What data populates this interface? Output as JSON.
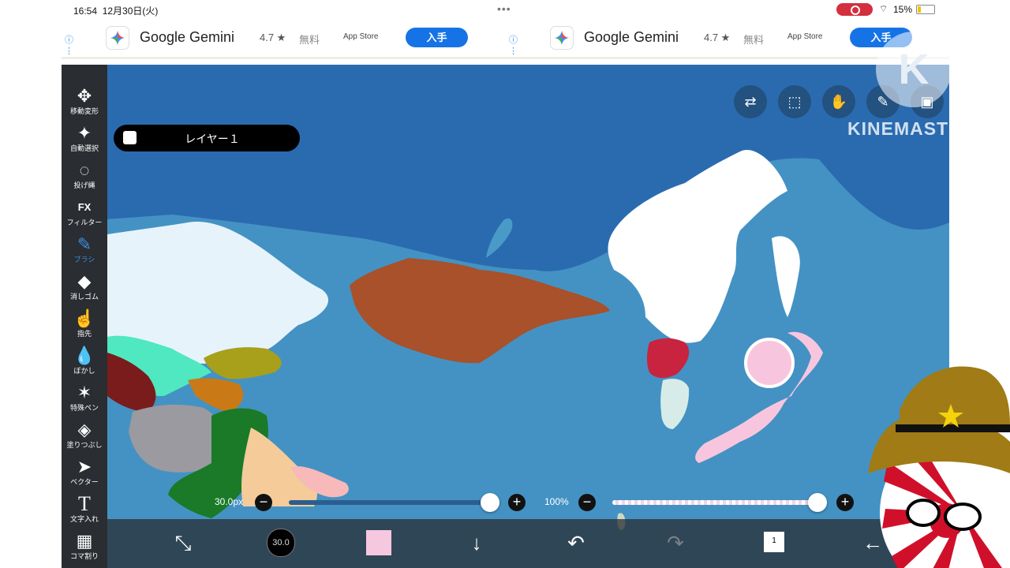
{
  "status_bar": {
    "time": "16:54",
    "date": "12月30日(火)",
    "battery": "15%"
  },
  "ads": [
    {
      "app_name": "Google Gemini",
      "rating": "4.7 ★",
      "price": "無料",
      "store": "App Store",
      "get_label": "入手"
    },
    {
      "app_name": "Google Gemini",
      "rating": "4.7 ★",
      "price": "無料",
      "store": "App Store",
      "get_label": "入手"
    }
  ],
  "toolbar": {
    "items": [
      {
        "label": "移動変形",
        "icon": "move-icon"
      },
      {
        "label": "自動選択",
        "icon": "magic-wand-icon"
      },
      {
        "label": "投げ縄",
        "icon": "lasso-icon"
      },
      {
        "label": "フィルター",
        "icon": "fx-icon"
      },
      {
        "label": "ブラシ",
        "icon": "brush-icon"
      },
      {
        "label": "消しゴム",
        "icon": "eraser-icon"
      },
      {
        "label": "指先",
        "icon": "finger-icon"
      },
      {
        "label": "ぼかし",
        "icon": "blur-icon"
      },
      {
        "label": "特殊ペン",
        "icon": "special-pen-icon"
      },
      {
        "label": "塗りつぶし",
        "icon": "fill-icon"
      },
      {
        "label": "ベクター",
        "icon": "vector-icon"
      },
      {
        "label": "文字入れ",
        "icon": "text-icon"
      },
      {
        "label": "コマ割り",
        "icon": "frame-icon"
      }
    ],
    "active": "ブラシ"
  },
  "layer": {
    "name": "レイヤー１"
  },
  "brush": {
    "size_label": "30.0px",
    "size_value": "30.0",
    "size_fraction": 1.0
  },
  "opacity": {
    "label": "100%",
    "fraction": 1.0
  },
  "current_color": "#f6c8e0",
  "watermark": {
    "text": "KINEMASTER",
    "logo": "K"
  },
  "layer_count": "1",
  "colors": {
    "ocean_dark": "#2a6bb0",
    "ocean_light": "#4a9ac8",
    "russia": "#ffffff",
    "mongolia": "#a8512a",
    "north_korea": "#c8243f",
    "south_korea": "#d7ece8",
    "japan": "#f7c6de",
    "kazakhstan": "#e6f3fb"
  }
}
